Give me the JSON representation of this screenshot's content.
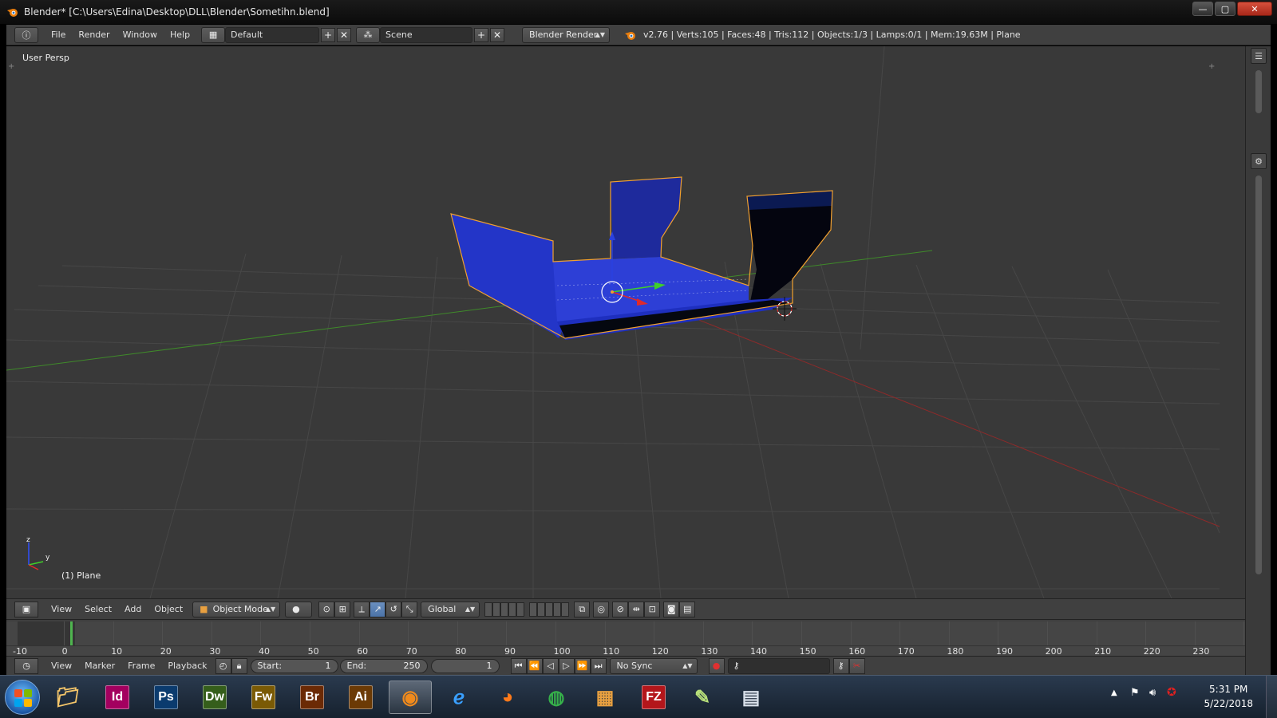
{
  "window": {
    "title": "Blender* [C:\\Users\\Edina\\Desktop\\DLL\\Blender\\Sometihn.blend]",
    "minimize": "—",
    "maximize": "▢",
    "close": "✕"
  },
  "info_header": {
    "menus": [
      "File",
      "Render",
      "Window",
      "Help"
    ],
    "layout": "Default",
    "scene": "Scene",
    "engine": "Blender Render",
    "stats": "v2.76 | Verts:105 | Faces:48 | Tris:112 | Objects:1/3 | Lamps:0/1 | Mem:19.63M | Plane"
  },
  "viewport": {
    "view_label": "User Persp",
    "object_label": "(1) Plane",
    "axis_z": "z",
    "axis_y": "y",
    "colors": {
      "background": "#393939",
      "grid": "#474747",
      "x_axis": "#8e2a2a",
      "y_axis": "#3f8a2a",
      "mesh": "#2335c8",
      "selection_outline": "#f0a030"
    }
  },
  "view3d_header": {
    "menus": [
      "View",
      "Select",
      "Add",
      "Object"
    ],
    "mode": "Object Mode",
    "orientation": "Global"
  },
  "timeline": {
    "ticks": [
      "-10",
      "0",
      "10",
      "20",
      "30",
      "40",
      "50",
      "60",
      "70",
      "80",
      "90",
      "100",
      "110",
      "120",
      "130",
      "140",
      "150",
      "160",
      "170",
      "180",
      "190",
      "200",
      "210",
      "220",
      "230"
    ],
    "current_frame": 1
  },
  "timeline_header": {
    "menus": [
      "View",
      "Marker",
      "Frame",
      "Playback"
    ],
    "start_label": "Start:",
    "start_value": "1",
    "end_label": "End:",
    "end_value": "250",
    "current": "1",
    "sync": "No Sync"
  },
  "taskbar": {
    "apps": [
      {
        "name": "file-explorer",
        "label": ""
      },
      {
        "name": "indesign",
        "label": "Id",
        "color": "#a3005f"
      },
      {
        "name": "photoshop",
        "label": "Ps",
        "color": "#0b3b6e"
      },
      {
        "name": "dreamweaver",
        "label": "Dw",
        "color": "#355e1b"
      },
      {
        "name": "fireworks",
        "label": "Fw",
        "color": "#7a5a05"
      },
      {
        "name": "bridge",
        "label": "Br",
        "color": "#6b2a05"
      },
      {
        "name": "illustrator",
        "label": "Ai",
        "color": "#6b3a05"
      },
      {
        "name": "blender",
        "label": ""
      },
      {
        "name": "internet-explorer",
        "label": ""
      },
      {
        "name": "firefox",
        "label": ""
      },
      {
        "name": "chrome",
        "label": ""
      },
      {
        "name": "paint",
        "label": ""
      },
      {
        "name": "filezilla",
        "label": "FZ",
        "color": "#b4161b"
      },
      {
        "name": "notepad",
        "label": ""
      },
      {
        "name": "calculator",
        "label": ""
      }
    ],
    "time": "5:31 PM",
    "date": "5/22/2018"
  }
}
